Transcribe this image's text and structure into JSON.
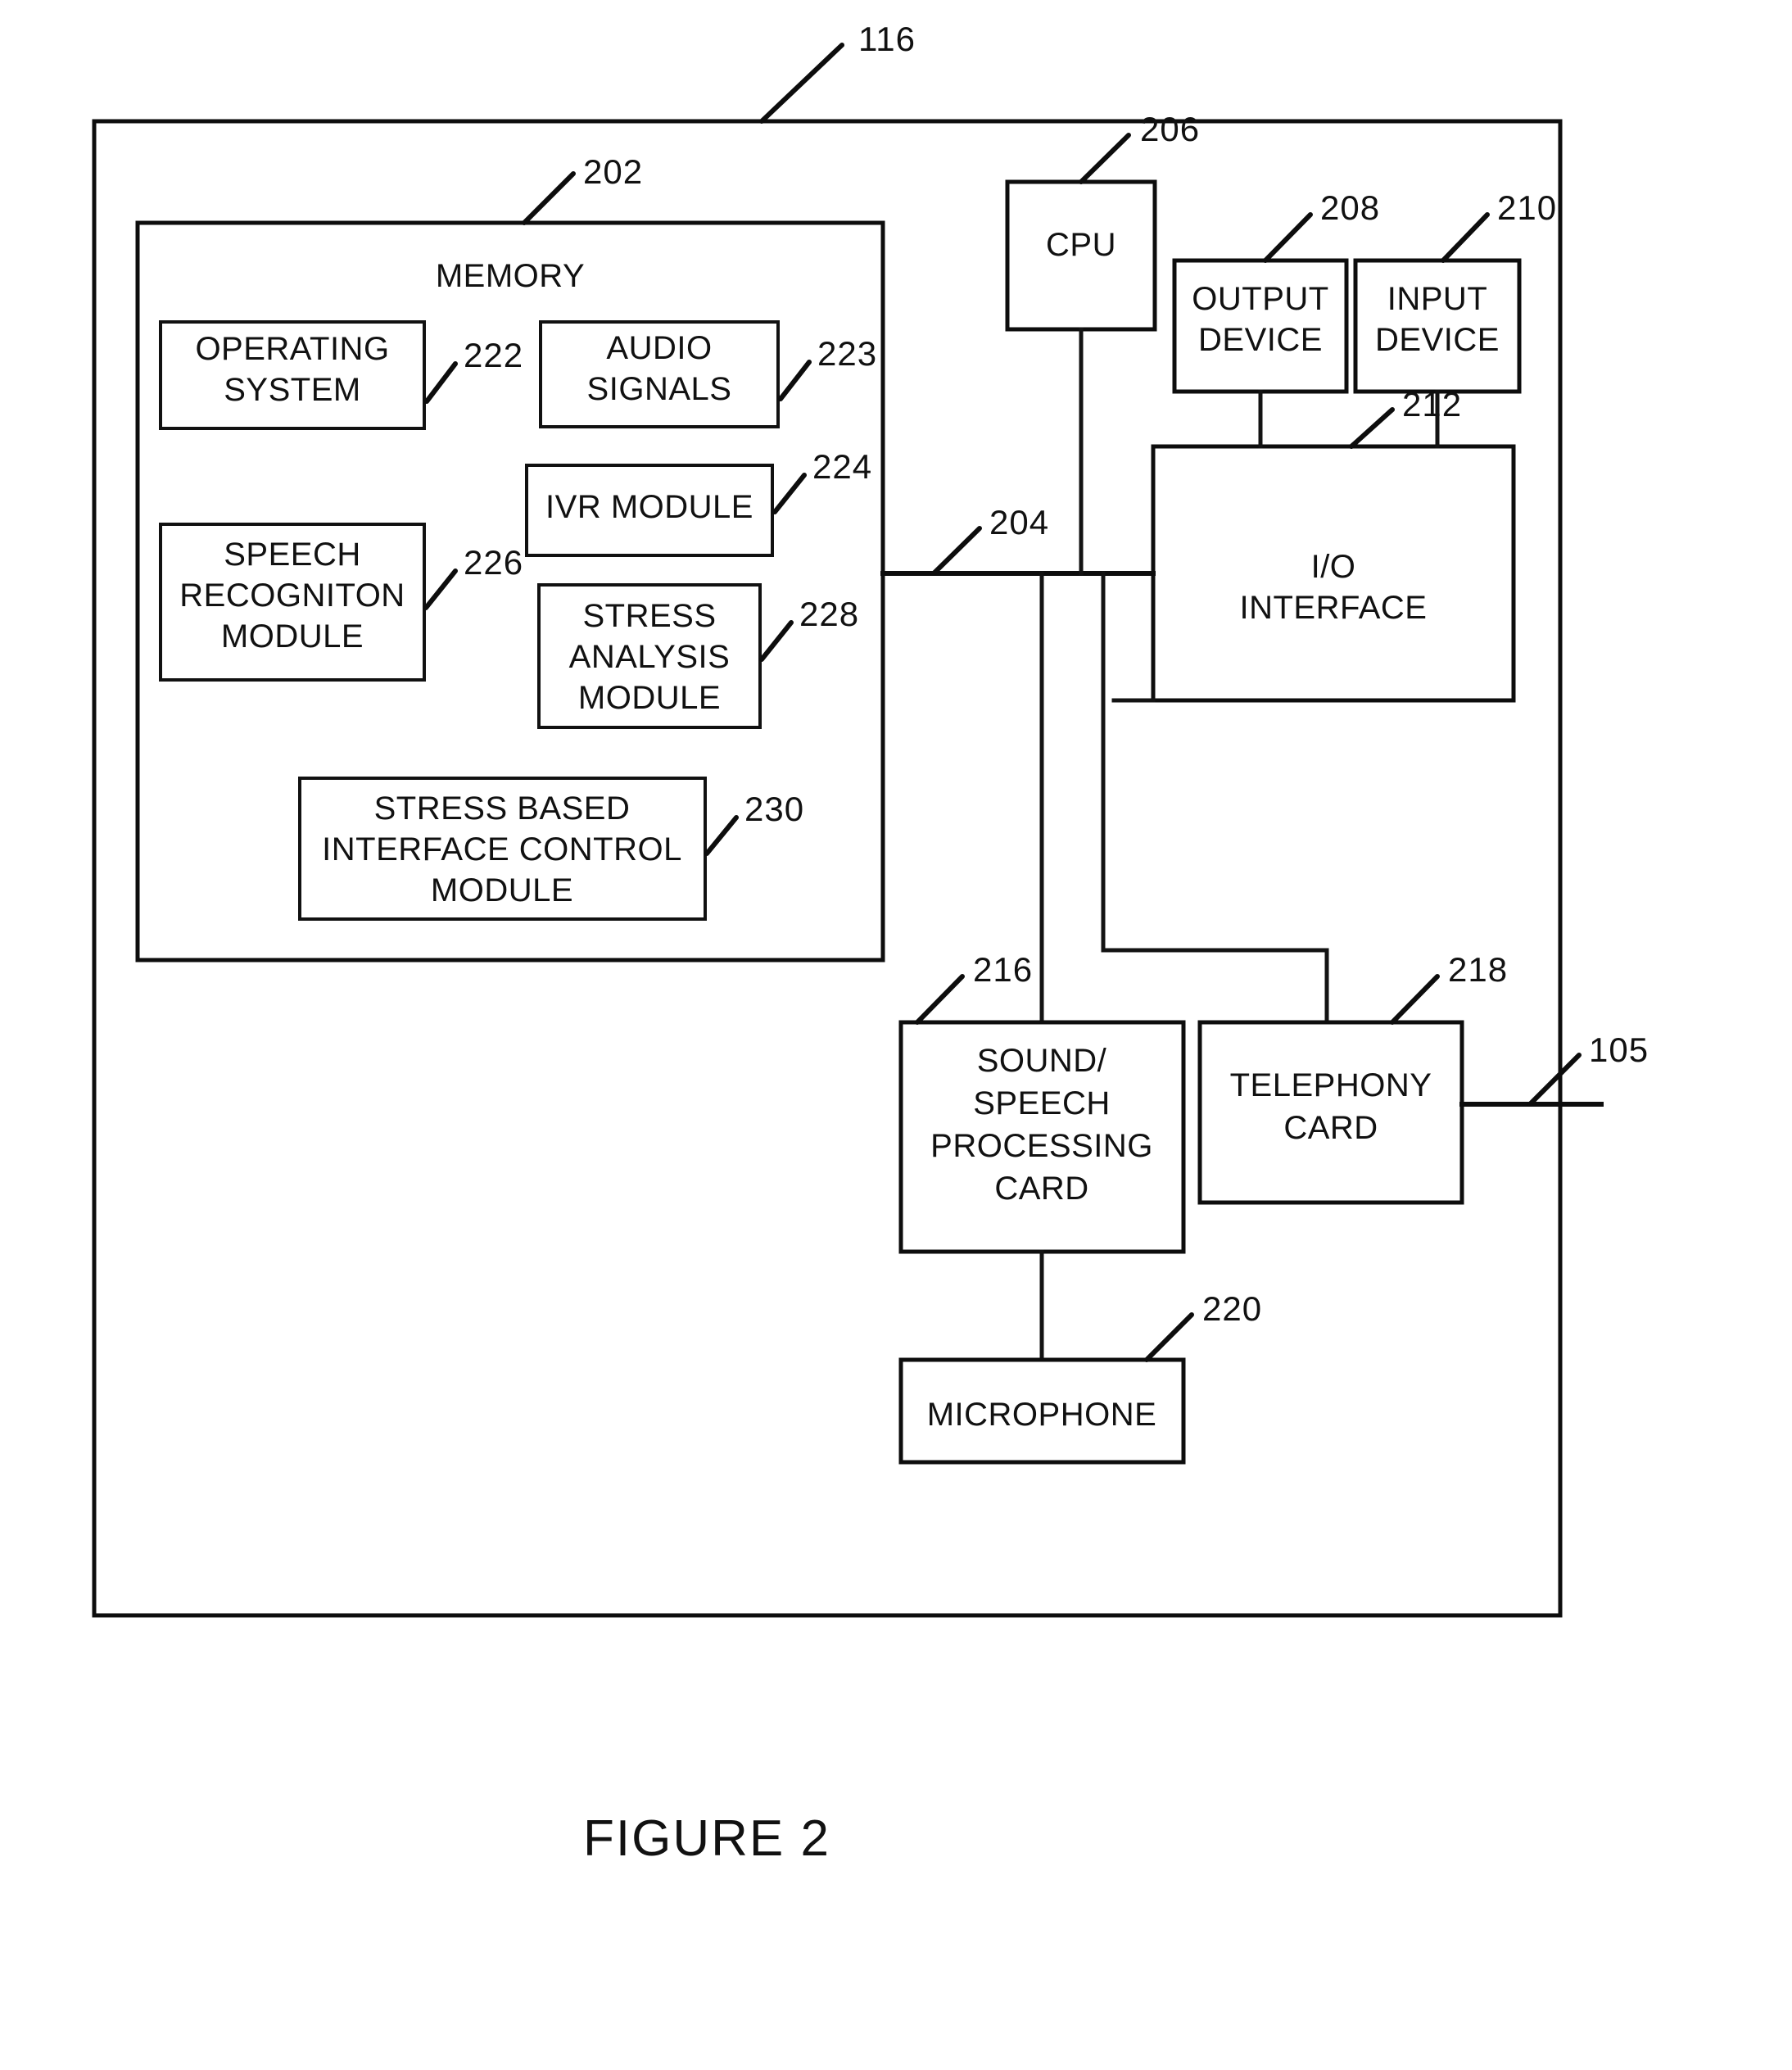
{
  "figure": {
    "caption": "FIGURE 2",
    "outer_label": "116"
  },
  "blocks": {
    "memory": {
      "title": "MEMORY",
      "ref": "202",
      "modules": [
        {
          "id": "operating_system",
          "lines": [
            "OPERATING",
            "SYSTEM"
          ],
          "ref": "222"
        },
        {
          "id": "audio_signals",
          "lines": [
            "AUDIO",
            "SIGNALS"
          ],
          "ref": "223"
        },
        {
          "id": "ivr_module",
          "lines": [
            "IVR MODULE"
          ],
          "ref": "224"
        },
        {
          "id": "speech_recognition_module",
          "lines": [
            "SPEECH",
            "RECOGNITON",
            "MODULE"
          ],
          "ref": "226"
        },
        {
          "id": "stress_analysis_module",
          "lines": [
            "STRESS",
            "ANALYSIS",
            "MODULE"
          ],
          "ref": "228"
        },
        {
          "id": "stress_based_interface_control_module",
          "lines": [
            "STRESS BASED",
            "INTERFACE CONTROL",
            "MODULE"
          ],
          "ref": "230"
        }
      ]
    },
    "cpu": {
      "lines": [
        "CPU"
      ],
      "ref": "206"
    },
    "output_device": {
      "lines": [
        "OUTPUT",
        "DEVICE"
      ],
      "ref": "208"
    },
    "input_device": {
      "lines": [
        "INPUT",
        "DEVICE"
      ],
      "ref": "210"
    },
    "io_interface": {
      "lines": [
        "I/O",
        "INTERFACE"
      ],
      "ref": "212"
    },
    "sound_speech_processing_card": {
      "lines": [
        "SOUND/",
        "SPEECH",
        "PROCESSING",
        "CARD"
      ],
      "ref": "216"
    },
    "telephony_card": {
      "lines": [
        "TELEPHONY",
        "CARD"
      ],
      "ref": "218"
    },
    "microphone": {
      "lines": [
        "MICROPHONE"
      ],
      "ref": "220"
    }
  },
  "bus": {
    "ref": "204"
  },
  "network_line": {
    "ref": "105"
  },
  "colors": {
    "ink": "#0d0d0d",
    "paper": "#ffffff"
  }
}
